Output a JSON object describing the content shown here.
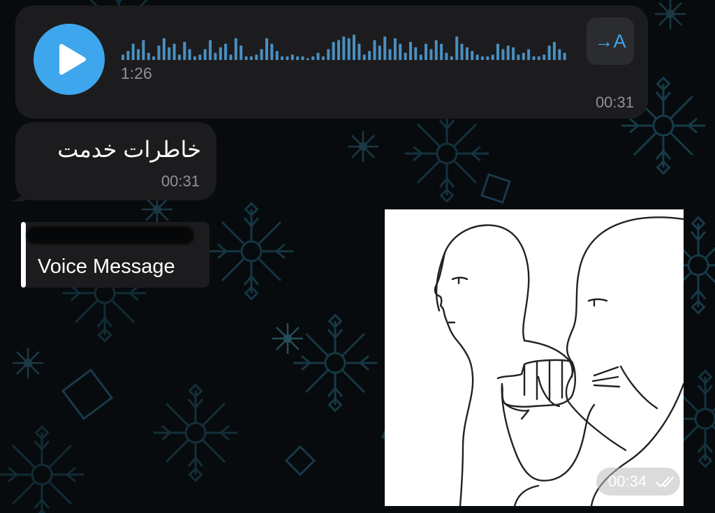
{
  "voice_message": {
    "play_icon": "play-icon",
    "duration": "1:26",
    "transcribe_label": "→A",
    "time": "00:31",
    "accent_color": "#3ea6ec"
  },
  "text_message": {
    "text": "خاطرات خدمت",
    "time": "00:31"
  },
  "reply_preview": {
    "label": "Voice Message"
  },
  "image_message": {
    "time": "00:34",
    "status_icon": "double-check-icon"
  }
}
